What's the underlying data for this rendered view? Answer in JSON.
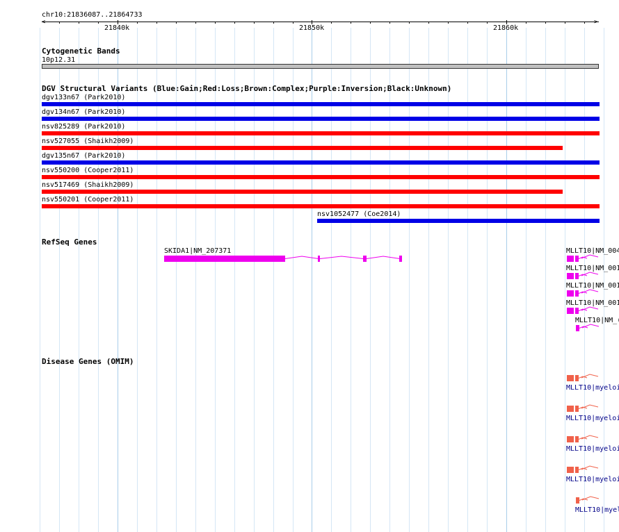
{
  "ruler": {
    "range": "chr10:21836087..21864733",
    "ticks": [
      "21840k",
      "21850k",
      "21860k"
    ]
  },
  "cytoband": {
    "title": "Cytogenetic Bands",
    "band": "10p12.31"
  },
  "dgv": {
    "title": "DGV Structural Variants (Blue:Gain;Red:Loss;Brown:Complex;Purple:Inversion;Black:Unknown)",
    "items": [
      {
        "label": "dgv133n67 (Park2010)",
        "type": "gain"
      },
      {
        "label": "dgv134n67 (Park2010)",
        "type": "gain"
      },
      {
        "label": "nsv825289 (Park2010)",
        "type": "loss"
      },
      {
        "label": "nsv527055 (Shaikh2009)",
        "type": "loss"
      },
      {
        "label": "dgv135n67 (Park2010)",
        "type": "gain"
      },
      {
        "label": "nsv550200 (Cooper2011)",
        "type": "loss"
      },
      {
        "label": "nsv517469 (Shaikh2009)",
        "type": "loss"
      },
      {
        "label": "nsv550201 (Cooper2011)",
        "type": "loss"
      },
      {
        "label": "nsv1052477 (Coe2014)",
        "type": "gain"
      }
    ]
  },
  "refseq": {
    "title": "RefSeq Genes",
    "genes": [
      {
        "label": "SKIDA1|NM_207371"
      },
      {
        "label": "MLLT10|NM_004"
      },
      {
        "label": "MLLT10|NM_001"
      },
      {
        "label": "MLLT10|NM_001"
      },
      {
        "label": "MLLT10|NM_001"
      },
      {
        "label": "MLLT10|NM_("
      }
    ]
  },
  "omim": {
    "title": "Disease Genes (OMIM)",
    "items": [
      {
        "label": "MLLT10|myeloi"
      },
      {
        "label": "MLLT10|myeloi"
      },
      {
        "label": "MLLT10|myeloi"
      },
      {
        "label": "MLLT10|myeloi"
      },
      {
        "label": "MLLT10|myel"
      }
    ]
  },
  "colors": {
    "gain": "#0000e6",
    "loss": "#ff0000",
    "gene": "#ee00ee",
    "omim": "#f0614a",
    "grid_major": "#a8cdea",
    "grid_minor": "#d4e6f5"
  }
}
